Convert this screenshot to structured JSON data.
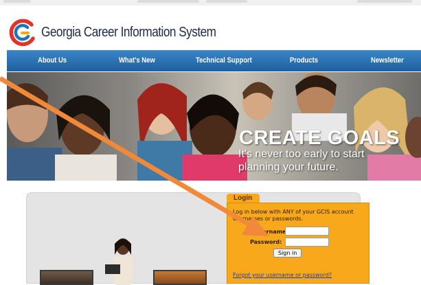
{
  "site": {
    "brand_name": "Georgia Career Information System"
  },
  "nav": {
    "items": [
      "About Us",
      "What's New",
      "Technical Support",
      "Products",
      "Newsletter"
    ]
  },
  "hero": {
    "headline": "CREATE GOALS",
    "subline": "It's never too early to start planning your future."
  },
  "login": {
    "tab_label": "Login",
    "instructions": "Log in below with ANY of your GCIS account usernames or passwords.",
    "username_label": "Username:",
    "password_label": "Password:",
    "username_value": "",
    "password_value": "",
    "sign_in_label": "Sign in",
    "forgot_link": "Forgot your username or password?"
  },
  "colors": {
    "nav_blue": "#2a72b5",
    "login_orange": "#f7a81b",
    "arrow_orange": "#f08a3a",
    "logo_red": "#e2342b",
    "logo_blue": "#1f73b7"
  },
  "icons": {
    "logo": "gcis-swirl-logo",
    "arrow": "annotation-arrow"
  }
}
